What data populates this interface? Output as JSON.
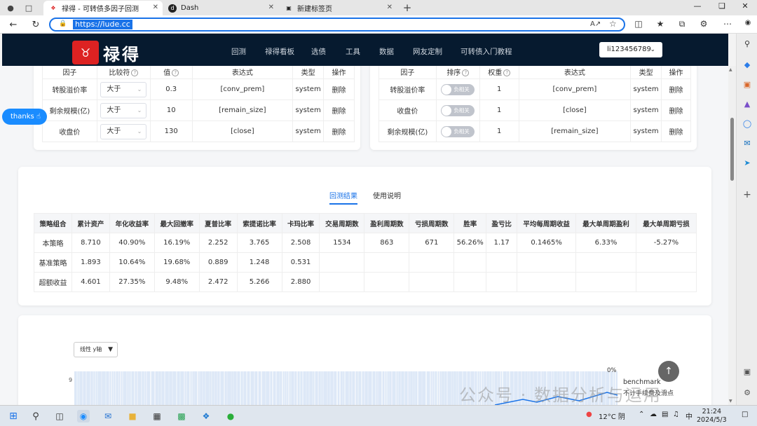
{
  "browser": {
    "tabs": [
      {
        "title": "禄得 - 可转债多因子回测",
        "active": true
      },
      {
        "title": "Dash",
        "active": false
      },
      {
        "title": "新建标签页",
        "active": false
      }
    ],
    "url": "https://lude.cc"
  },
  "site": {
    "logo_text": "禄得",
    "nav": [
      "回测",
      "禄得看板",
      "选债",
      "工具",
      "数据",
      "网友定制",
      "可转债入门教程"
    ],
    "user": "li123456789"
  },
  "filter_table": {
    "headers": [
      "因子",
      "比较符",
      "值",
      "表达式",
      "类型",
      "操作"
    ],
    "rows": [
      {
        "factor": "转股溢价率",
        "op": "大于",
        "value": "0.3",
        "expr": "[conv_prem]",
        "type": "system",
        "action": "删除"
      },
      {
        "factor": "剩余规模(亿)",
        "op": "大于",
        "value": "10",
        "expr": "[remain_size]",
        "type": "system",
        "action": "删除"
      },
      {
        "factor": "收盘价",
        "op": "大于",
        "value": "130",
        "expr": "[close]",
        "type": "system",
        "action": "删除"
      }
    ]
  },
  "sort_table": {
    "headers": [
      "因子",
      "排序",
      "权重",
      "表达式",
      "类型",
      "操作"
    ],
    "rows": [
      {
        "factor": "转股溢价率",
        "switch": "负相关",
        "weight": "1",
        "expr": "[conv_prem]",
        "type": "system",
        "action": "删除"
      },
      {
        "factor": "收盘价",
        "switch": "负相关",
        "weight": "1",
        "expr": "[close]",
        "type": "system",
        "action": "删除"
      },
      {
        "factor": "剩余规模(亿)",
        "switch": "负相关",
        "weight": "1",
        "expr": "[remain_size]",
        "type": "system",
        "action": "删除"
      }
    ]
  },
  "thanks": "thanks",
  "results": {
    "tabs": [
      "回测结果",
      "使用说明"
    ],
    "headers": [
      "策略组合",
      "累计资产",
      "年化收益率",
      "最大回撤率",
      "夏普比率",
      "索提诺比率",
      "卡玛比率",
      "交易周期数",
      "盈利周期数",
      "亏损周期数",
      "胜率",
      "盈亏比",
      "平均每周期收益",
      "最大单周期盈利",
      "最大单周期亏损"
    ],
    "rows": [
      [
        "本策略",
        "8.710",
        "40.90%",
        "16.19%",
        "2.252",
        "3.765",
        "2.508",
        "1534",
        "863",
        "671",
        "56.26%",
        "1.17",
        "0.1465%",
        "6.33%",
        "-5.27%"
      ],
      [
        "基准策略",
        "1.893",
        "10.64%",
        "19.68%",
        "0.889",
        "1.248",
        "0.531",
        "",
        "",
        "",
        "",
        "",
        "",
        "",
        ""
      ],
      [
        "超额收益",
        "4.601",
        "27.35%",
        "9.48%",
        "2.472",
        "5.266",
        "2.880",
        "",
        "",
        "",
        "",
        "",
        "",
        "",
        ""
      ]
    ]
  },
  "chart": {
    "y_axis_select": "线性 y轴",
    "y_tick": "9",
    "right_label": "0%",
    "legend": "benchmark",
    "legend_sub": "不计手续费及滑点"
  },
  "watermark": "公众号 · 数据分析与运用",
  "taskbar": {
    "weather": "12°C 阴",
    "ime": "中",
    "time": "21:24",
    "date": "2024/5/3"
  },
  "colors": {
    "accent": "#1a73e8",
    "nav_bg": "#061a2f",
    "danger": "#e0454b",
    "thanks": "#1a8cff"
  }
}
